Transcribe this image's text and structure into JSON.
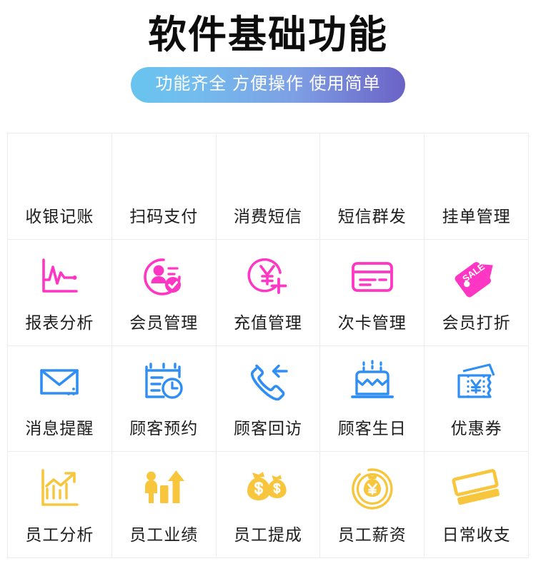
{
  "header": {
    "title": "软件基础功能",
    "subtitle": "功能齐全 方便操作 使用简单",
    "subtitle_gradient_from": "#68c4ee",
    "subtitle_gradient_to": "#6a62c6"
  },
  "theme": {
    "row1_gradient_from": "#2b7cf7",
    "row1_gradient_to": "#ff2fd0",
    "row2_color": "#ff36c4",
    "row2_color_soft": "#fb7ae6",
    "row3_color": "#2f8ef4",
    "row4_color": "#f8c63c",
    "grid_line": "#ececec",
    "label_color": "#1d1d1d"
  },
  "grid": {
    "columns": 5,
    "rows": 4,
    "cells": [
      {
        "label": "收银记账",
        "icon": "monitor-cursor-icon",
        "style": "gradient"
      },
      {
        "label": "扫码支付",
        "icon": "qr-scan-icon",
        "style": "gradient"
      },
      {
        "label": "消费短信",
        "icon": "chat-bubble-dots-icon",
        "style": "gradient"
      },
      {
        "label": "短信群发",
        "icon": "message-broadcast-icon",
        "style": "gradient"
      },
      {
        "label": "挂单管理",
        "icon": "document-lines-icon",
        "style": "gradient"
      },
      {
        "label": "报表分析",
        "icon": "line-chart-icon",
        "style": "pink"
      },
      {
        "label": "会员管理",
        "icon": "member-check-icon",
        "style": "pink"
      },
      {
        "label": "充值管理",
        "icon": "yuan-plus-icon",
        "style": "pink"
      },
      {
        "label": "次卡管理",
        "icon": "credit-card-icon",
        "style": "pink"
      },
      {
        "label": "会员打折",
        "icon": "sale-tag-icon",
        "style": "pink",
        "badge_text": "SALE"
      },
      {
        "label": "消息提醒",
        "icon": "envelope-icon",
        "style": "blue"
      },
      {
        "label": "顾客预约",
        "icon": "calendar-clock-icon",
        "style": "blue"
      },
      {
        "label": "顾客回访",
        "icon": "phone-callback-icon",
        "style": "blue"
      },
      {
        "label": "顾客生日",
        "icon": "birthday-cake-icon",
        "style": "blue"
      },
      {
        "label": "优惠券",
        "icon": "coupon-yuan-icon",
        "style": "blue"
      },
      {
        "label": "员工分析",
        "icon": "growth-chart-icon",
        "style": "yellow"
      },
      {
        "label": "员工业绩",
        "icon": "person-bar-arrow-icon",
        "style": "yellow"
      },
      {
        "label": "员工提成",
        "icon": "money-bags-icon",
        "style": "yellow"
      },
      {
        "label": "员工薪资",
        "icon": "coin-moneybag-icon",
        "style": "yellow"
      },
      {
        "label": "日常收支",
        "icon": "banknotes-icon",
        "style": "yellow"
      }
    ]
  }
}
